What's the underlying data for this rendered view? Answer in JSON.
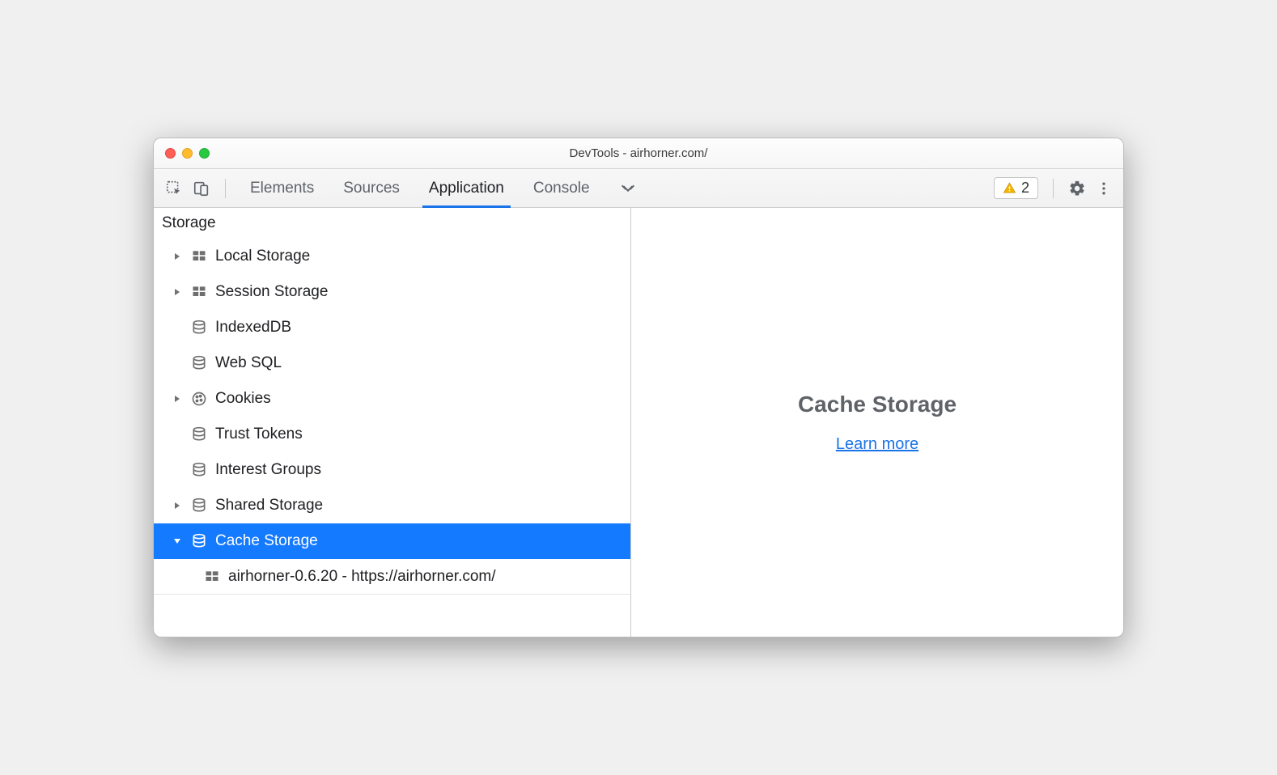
{
  "window_title": "DevTools - airhorner.com/",
  "toolbar": {
    "tabs": [
      "Elements",
      "Sources",
      "Application",
      "Console"
    ],
    "active_tab": "Application",
    "issues_count": "2"
  },
  "sidebar": {
    "section_title": "Storage",
    "items": [
      {
        "label": "Local Storage",
        "icon": "grid",
        "arrow": "closed",
        "selected": false
      },
      {
        "label": "Session Storage",
        "icon": "grid",
        "arrow": "closed",
        "selected": false
      },
      {
        "label": "IndexedDB",
        "icon": "db",
        "arrow": "none",
        "selected": false
      },
      {
        "label": "Web SQL",
        "icon": "db",
        "arrow": "none",
        "selected": false
      },
      {
        "label": "Cookies",
        "icon": "cookie",
        "arrow": "closed",
        "selected": false
      },
      {
        "label": "Trust Tokens",
        "icon": "db",
        "arrow": "none",
        "selected": false
      },
      {
        "label": "Interest Groups",
        "icon": "db",
        "arrow": "none",
        "selected": false
      },
      {
        "label": "Shared Storage",
        "icon": "db",
        "arrow": "closed",
        "selected": false
      },
      {
        "label": "Cache Storage",
        "icon": "db",
        "arrow": "open",
        "selected": true,
        "children": [
          {
            "label": "airhorner-0.6.20 - https://airhorner.com/",
            "icon": "grid"
          }
        ]
      }
    ]
  },
  "content": {
    "heading": "Cache Storage",
    "link_text": "Learn more"
  }
}
